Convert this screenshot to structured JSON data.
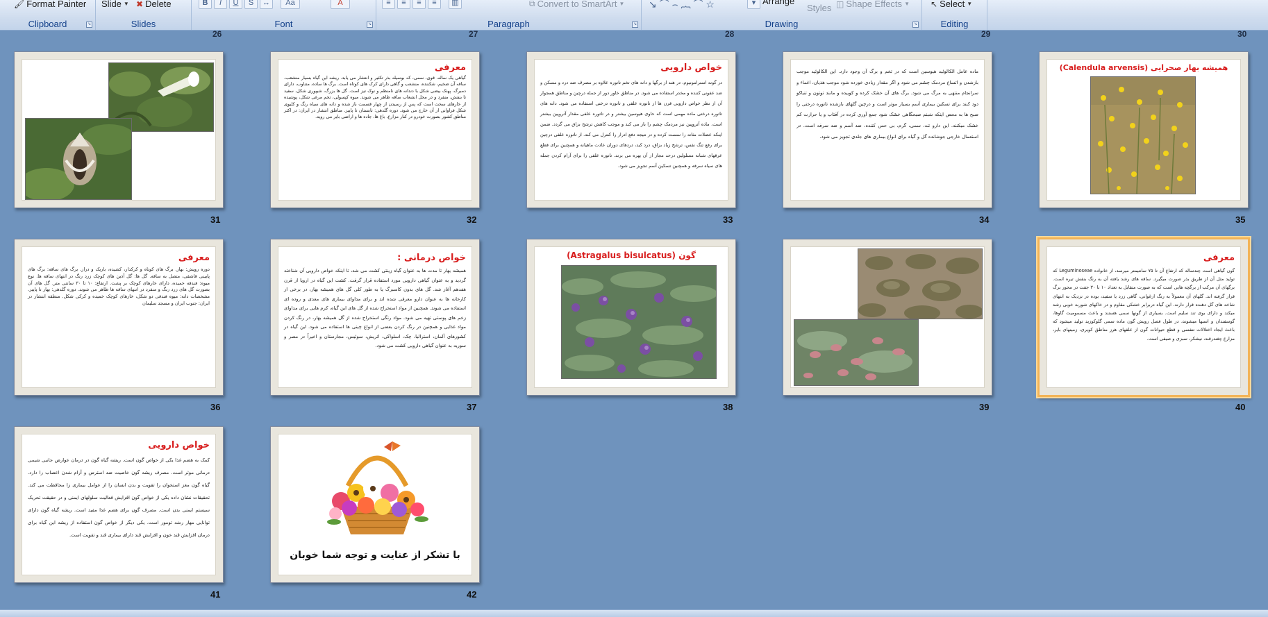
{
  "ribbon": {
    "clipboard": {
      "format_painter": "Format Painter",
      "label": "Clipboard"
    },
    "slides": {
      "new_slide": "Slide",
      "delete": "Delete",
      "label": "Slides"
    },
    "font": {
      "label": "Font"
    },
    "paragraph": {
      "convert_smartart": "Convert to SmartArt",
      "label": "Paragraph"
    },
    "drawing": {
      "arrange": "Arrange",
      "quick_styles": "Styles",
      "shape_effects": "Shape Effects",
      "label": "Drawing"
    },
    "editing": {
      "select": "Select",
      "label": "Editing"
    }
  },
  "top_row_numbers": [
    "26",
    "27",
    "28",
    "29",
    "30"
  ],
  "slides": [
    {
      "number": "31",
      "title": "",
      "body": ""
    },
    {
      "number": "32",
      "title": "معرفی",
      "body": "گیاهی یک ساله، قوی، سمی، که بوسیله بذر تکثیر و انتشار می یابد. ریشه این گیاه بسیار منشعب، ساقه آن ضخیم، شکننده، منشعب و گاهی دارای کرک های کوتاه است. برگ ها ساده، متناوب، دارای دمبرگ، پهنک بیضی شکل با دندانه های نامنظم و نوک تیز است. گل ها بزرگ، شیپوری شکل، سفید تا بنفش، منفرد و در محل انشعاب ساقه ظاهر می شوند. میوه کپسولی، تخم مرغی شکل، پوشیده از خارهای سخت است که پس از رسیدن از چهار قسمت باز شده و دانه های سیاه رنگ و کلیوی شکل فراوانی از آن خارج می شود. دوره گلدهی: تابستان تا پاییز. مناطق انتشار در ایران: در اکثر مناطق کشور بصورت خودرو در کنار مزارع، باغ ها، جاده ها و اراضی بایر می روید."
    },
    {
      "number": "33",
      "title": "خواص دارویی",
      "body": "در گونه استرامونیوم، در هند از برگها و دانه های تخم تاتوره علاوه بر مصرف ضد درد و مسکن و ضد عفونی کننده و مخدر استفاده می شود. در مناطق خاور دور از جمله درچین و مناطق همجوار آن از نظر خواص دارویی قرن ها از تاتوره علفی و تاتوره درختی استفاده می شود. دانه های تاتوره درختی ماده مهمی است که حاوی هیوسین بیشتر و در تاتوره علفی مقدار آتروپین بیشتر است. ماده آتروپین نیز مردمک چشم را باز می کند و موجب کاهش ترشح بزاق می گردد. ضمن اینکه عضلات مثانه را سست کرده و در نتیجه دفع ادرار را کنترل می کند. از تاتوره علفی درچین برای رفع تنگ نفس، ترشح زیاد بزاق، درد کبد، دردهای دوران عادت ماهیانه و همچنین برای قطع عرقهای شبانه مسلولین درحد مجاز از آن بهره می برند. تاتوره علفی را برای آرام کردن جمله های سیاه سرفه و همچنین تسکین آسم تجویز می شود."
    },
    {
      "number": "34",
      "title": "",
      "body": "ماده عامل الکالوئید هیوسین است که در تخم و برگ آن وجود دارد. این الکالوئید موجب بازشدن و اتساع مردمک چشم می شود و اگر مقدار زیادی خورده شود موجب هذیان، اغماء و سرانجام منتهی به مرگ می شود. برگ های آن خشک کرده و کوبیده و مانند توتون و تنباکو دود کنند برای تسکین بیماری آسم بسیار موثر است و درچین گلهای بازشده تاتوره درختی را صبح ها به محض اینکه شبنم صبحگاهی خشک شود جمع آوری کرده در آفتاب و یا حرارت کم خشک میکنند. این دارو تند، سمی، گرم، بی حس کننده، ضد آسم و ضد سرفه است. در استعمال خارجی جوشانده گل و گیاه برای انواع بیماری های جلدی تجویز می شود."
    },
    {
      "number": "35",
      "title": "همیشه بهار صحرایی (Calendula arvensis)",
      "body": ""
    },
    {
      "number": "36",
      "title": "معرفی",
      "body": "دوره رویش: بهار. برگ های کوتاه و کرکدار، کشیده، باریک و دراز. برگ های ساقه: برگ های پایینی قاشقی، متصل به ساقه. گل ها: گل آذین های کوچک زرد رنگ در انتهای ساقه ها. نوع میوه: فندقه خمیده، دارای خارهای کوچک بر پشت. ارتفاع: ۱۰ تا ۳۰ سانتی متر. گل های آن بصورت گل های زرد رنگ و منفرد در انتهای ساقه ها ظاهر می شوند. دوره گلدهی: بهار تا پاییز. مشخصات دانه: میوه فندقی دو شکل، خارهای کوچک خمیده و کرکی شکل. منطقه انتشار در ایران: جنوب ایران و مسجد سلیمان"
    },
    {
      "number": "37",
      "title": "خواص درمانی :",
      "body": "همیشه بهار تا مدت ها به عنوان گیاه زینتی کشت می شد، تا اینکه خواص دارویی آن شناخته گردید و به عنوان گیاهی دارویی مورد استفاده قرار گرفت. کشت این گیاه در اروپا از قرن هفدهم آغاز شد. گل های بدون کاسبرگ یا به طور کلی گل های همیشه بهار، در برخی از کارخانه ها به عنوان دارو معرفی شده اند و برای مداوای بیماری های معدی و روده ای استفاده می شوند. همچنین از مواد استخراج شده از گل های این گیاه، کرم هایی برای مداوای زخم های پوستی تهیه می شود. مواد رنگی استخراج شده از گل همیشه بهار، در رنگ کردن مواد غذایی و همچنین در رنگ کردن بعضی از انواع چینی ها استفاده می شود. این گیاه در کشورهای آلمان، استرالیا، چک، اسلواکی، اتریش، سوئیس، مجارستان و اخیراً در مصر و سوریه به عنوان گیاهی دارویی کشت می شود."
    },
    {
      "number": "38",
      "title": "گون (Astragalus bisulcatus)",
      "body": ""
    },
    {
      "number": "39",
      "title": "",
      "body": ""
    },
    {
      "number": "40",
      "title": "معرفی",
      "body": "گون گیاهی است چندساله که ارتفاع آن تا ۷۵ سانتیمتر میرسد، از خانواده Leguminoseae که تولید مثل آن از طریق بذر صورت میگیرد. ساقه های رشد یافته آن به رنگ بنفش تیره است. برگهای آن مرکب از برگچه هایی است که به صورت متقابل به تعداد ۱۰ تا ۳۰ جفت در محور برگ قرار گرفته اند. گلهای آن معمولاً به رنگ ارغوانی، گاهی زرد یا سفید، بوده در نزدیک به انتهای شاخه های گل دهنده قرار دارند. این گیاه دربرابر خشکی مقاوم و در خاکهای شوربه خوبی رشد میکند و دارای بوی تند سلیم است. بسیاری از گونها سمی هستند و باعث مسمومیت گاوها، گوسفندان و اسبها میشوند، در طول فصل رویش گون ماده سمی گلوکوزید تولید میشود که باعث ایجاد اختلالات تنفسی و قطع حیوانات گون از علفهای هرز مناطق کویری، زمینهای بایر، مزارع چغندرقند، نیشکر، سبزی و صیفی است."
    },
    {
      "number": "41",
      "title": "خواص دارویی",
      "body": "کمک به هضم غذا یکی از خواص گون است. ریشه گیاه گون در درمان عوارض جانبی شیمی درمانی موثر است. مصرف ریشه گون خاصیت ضد استرس و آرام شدن اعصاب را دارد. گیاه گون مغز استخوان را تقویت و بدن انسان را از عوامل بیماری زا محافظت می کند. تحقیقات نشان داده یکی از خواص گون افزایش فعالیت سلولهای ایمنی و در حقیقت تحریک سیستم ایمنی بدن است. مصرف گون برای هضم غذا مفید است. ریشه گیاه گون دارای توانایی مهار رشد تومور است. یکی دیگر از خواص گون استفاده از ریشه این گیاه برای درمان افزایش قند خون و افزایش قند دارای بیماری قند و تقویت است."
    },
    {
      "number": "42",
      "title": "",
      "thanks": "با تشکر از عنایت و توجه شما خوبان",
      "body": ""
    }
  ],
  "colors": {
    "background": "#6f93bd",
    "title_red": "#d81e1e",
    "selection": "#f3b457",
    "ribbon_label": "#15428b"
  }
}
